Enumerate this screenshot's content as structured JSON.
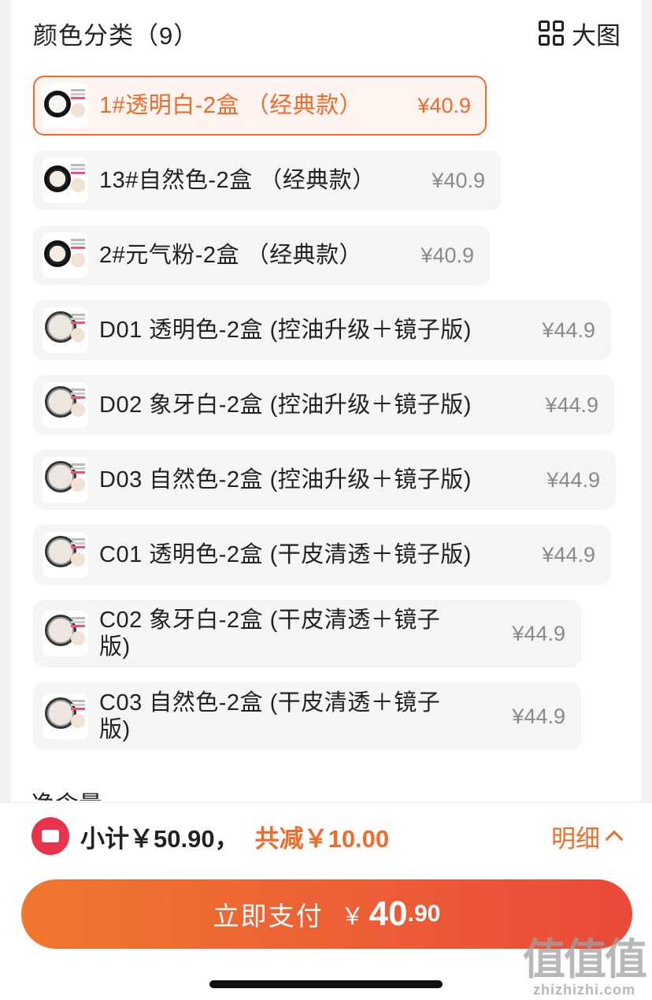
{
  "header": {
    "title": "颜色分类（9）",
    "big_view_label": "大图"
  },
  "items": [
    {
      "name": "1#透明白-2盒 （经典款）",
      "price": "¥40.9",
      "selected": true
    },
    {
      "name": "13#自然色-2盒 （经典款）",
      "price": "¥40.9",
      "selected": false
    },
    {
      "name": "2#元气粉-2盒 （经典款）",
      "price": "¥40.9",
      "selected": false
    },
    {
      "name": "D01 透明色-2盒 (控油升级＋镜子版)",
      "price": "¥44.9",
      "selected": false
    },
    {
      "name": "D02 象牙白-2盒 (控油升级＋镜子版)",
      "price": "¥44.9",
      "selected": false
    },
    {
      "name": "D03 自然色-2盒 (控油升级＋镜子版)",
      "price": "¥44.9",
      "selected": false
    },
    {
      "name": "C01 透明色-2盒 (干皮清透＋镜子版)",
      "price": "¥44.9",
      "selected": false
    },
    {
      "name": "C02 象牙白-2盒 (干皮清透＋镜子版)",
      "price": "¥44.9",
      "selected": false
    },
    {
      "name": "C03 自然色-2盒 (干皮清透＋镜子版)",
      "price": "¥44.9",
      "selected": false
    }
  ],
  "next_section_partial": "净含量",
  "footer": {
    "subtotal": "小计￥50.90，",
    "discount": "共减￥10.00",
    "detail_label": "明细",
    "pay_label": "立即支付",
    "pay_currency": "￥",
    "pay_integer": "40",
    "pay_decimal": ".90"
  },
  "watermark": {
    "main": "值值值",
    "site": "zhizhizhi.com"
  },
  "colors": {
    "accent": "#f06b2c",
    "selected_bg": "#fff4ef",
    "item_bg": "#f5f5f5",
    "pay_gradient_start": "#f0772f",
    "pay_gradient_end": "#ea4a3a",
    "coupon": "#e8334a"
  }
}
